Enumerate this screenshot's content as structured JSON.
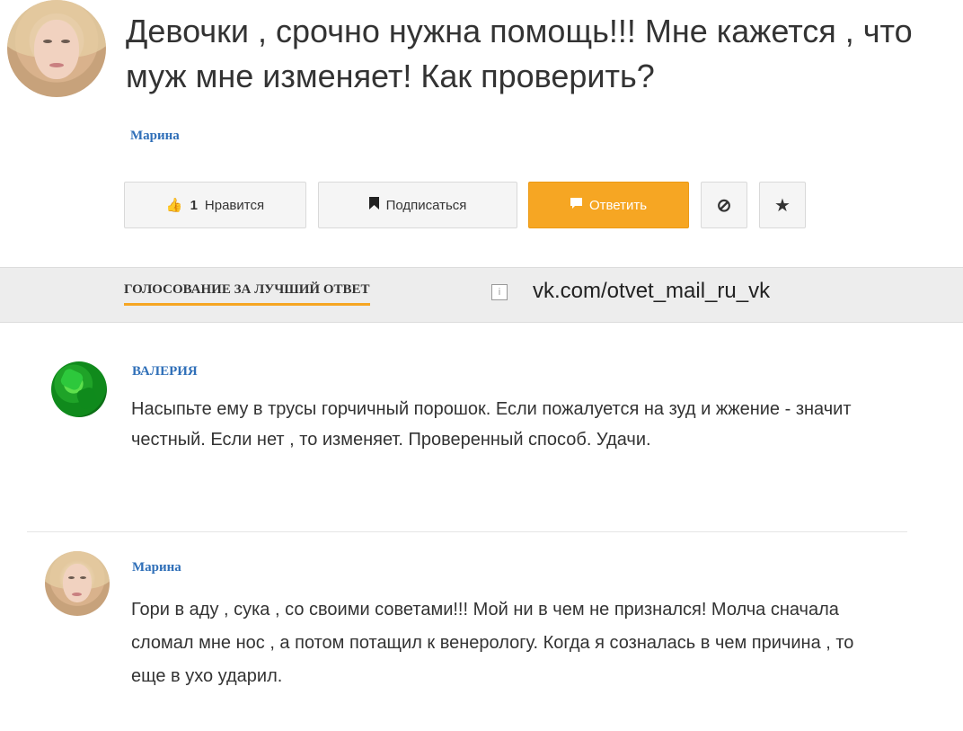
{
  "question": {
    "title": "Девочки , срочно нужна помощь!!! Мне кажется , что муж мне  изменяет! Как проверить?",
    "author": "Марина"
  },
  "actions": {
    "like_count": "1",
    "like_label": "Нравится",
    "follow_label": "Подписаться",
    "answer_label": "Ответить",
    "block_icon": "⊘",
    "favorite_icon": "★"
  },
  "vote_section": {
    "title": "ГОЛОСОВАНИЕ ЗА ЛУЧШИЙ ОТВЕТ",
    "watermark": "vk.com/otvet_mail_ru_vk"
  },
  "answers": [
    {
      "author": "ВАЛЕРИЯ",
      "text": "Насыпьте ему в трусы горчичный порошок. Если пожалуется на зуд и жжение - значит честный. Если нет , то изменяет. Проверенный способ. Удачи."
    },
    {
      "author": "Марина",
      "text": "Гори в аду , сука , со своими советами!!! Мой ни в чем не признался! Молча сначала сломал мне нос , а потом потащил к венерологу. Когда я созналась в чем причина , то еще в ухо ударил."
    }
  ],
  "colors": {
    "accent": "#f6a623",
    "link": "#2f6fb8"
  }
}
